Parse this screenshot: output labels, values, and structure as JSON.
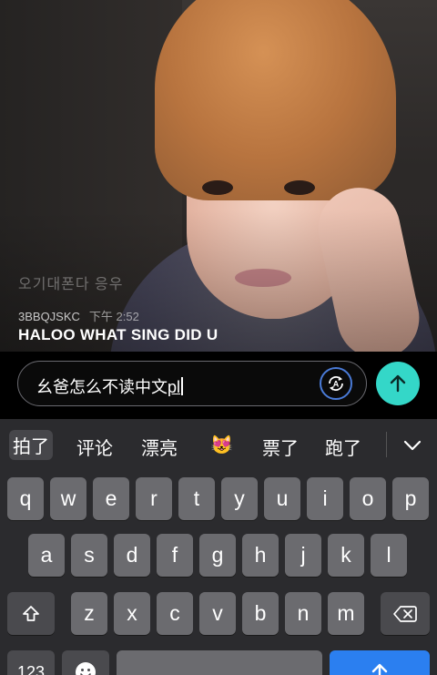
{
  "chat": {
    "faded_line": "오기대폰다 응우",
    "username": "3BBQJSKC",
    "timestamp": "下午 2:52",
    "message": "HALOO WHAT SING DID U"
  },
  "input": {
    "committed_text": "幺爸怎么不读中文",
    "composing_text": "pl"
  },
  "accent": {
    "send_bg": "#34d7c8",
    "translate_border": "#4a7bd8",
    "keyboard_bg": "#2b2b2e"
  },
  "icons": [
    "translate-icon",
    "send-arrow-icon",
    "chevron-down-icon",
    "shift-icon",
    "backspace-icon",
    "emoji-icon",
    "return-arrow-icon"
  ],
  "keyboard": {
    "candidates": [
      "拍了",
      "评论",
      "漂亮",
      "😻",
      "票了",
      "跑了"
    ],
    "row1": [
      "q",
      "w",
      "e",
      "r",
      "t",
      "y",
      "u",
      "i",
      "o",
      "p"
    ],
    "row2": [
      "a",
      "s",
      "d",
      "f",
      "g",
      "h",
      "j",
      "k",
      "l"
    ],
    "row3": [
      "z",
      "x",
      "c",
      "v",
      "b",
      "n",
      "m"
    ],
    "numbers_label": "123"
  }
}
